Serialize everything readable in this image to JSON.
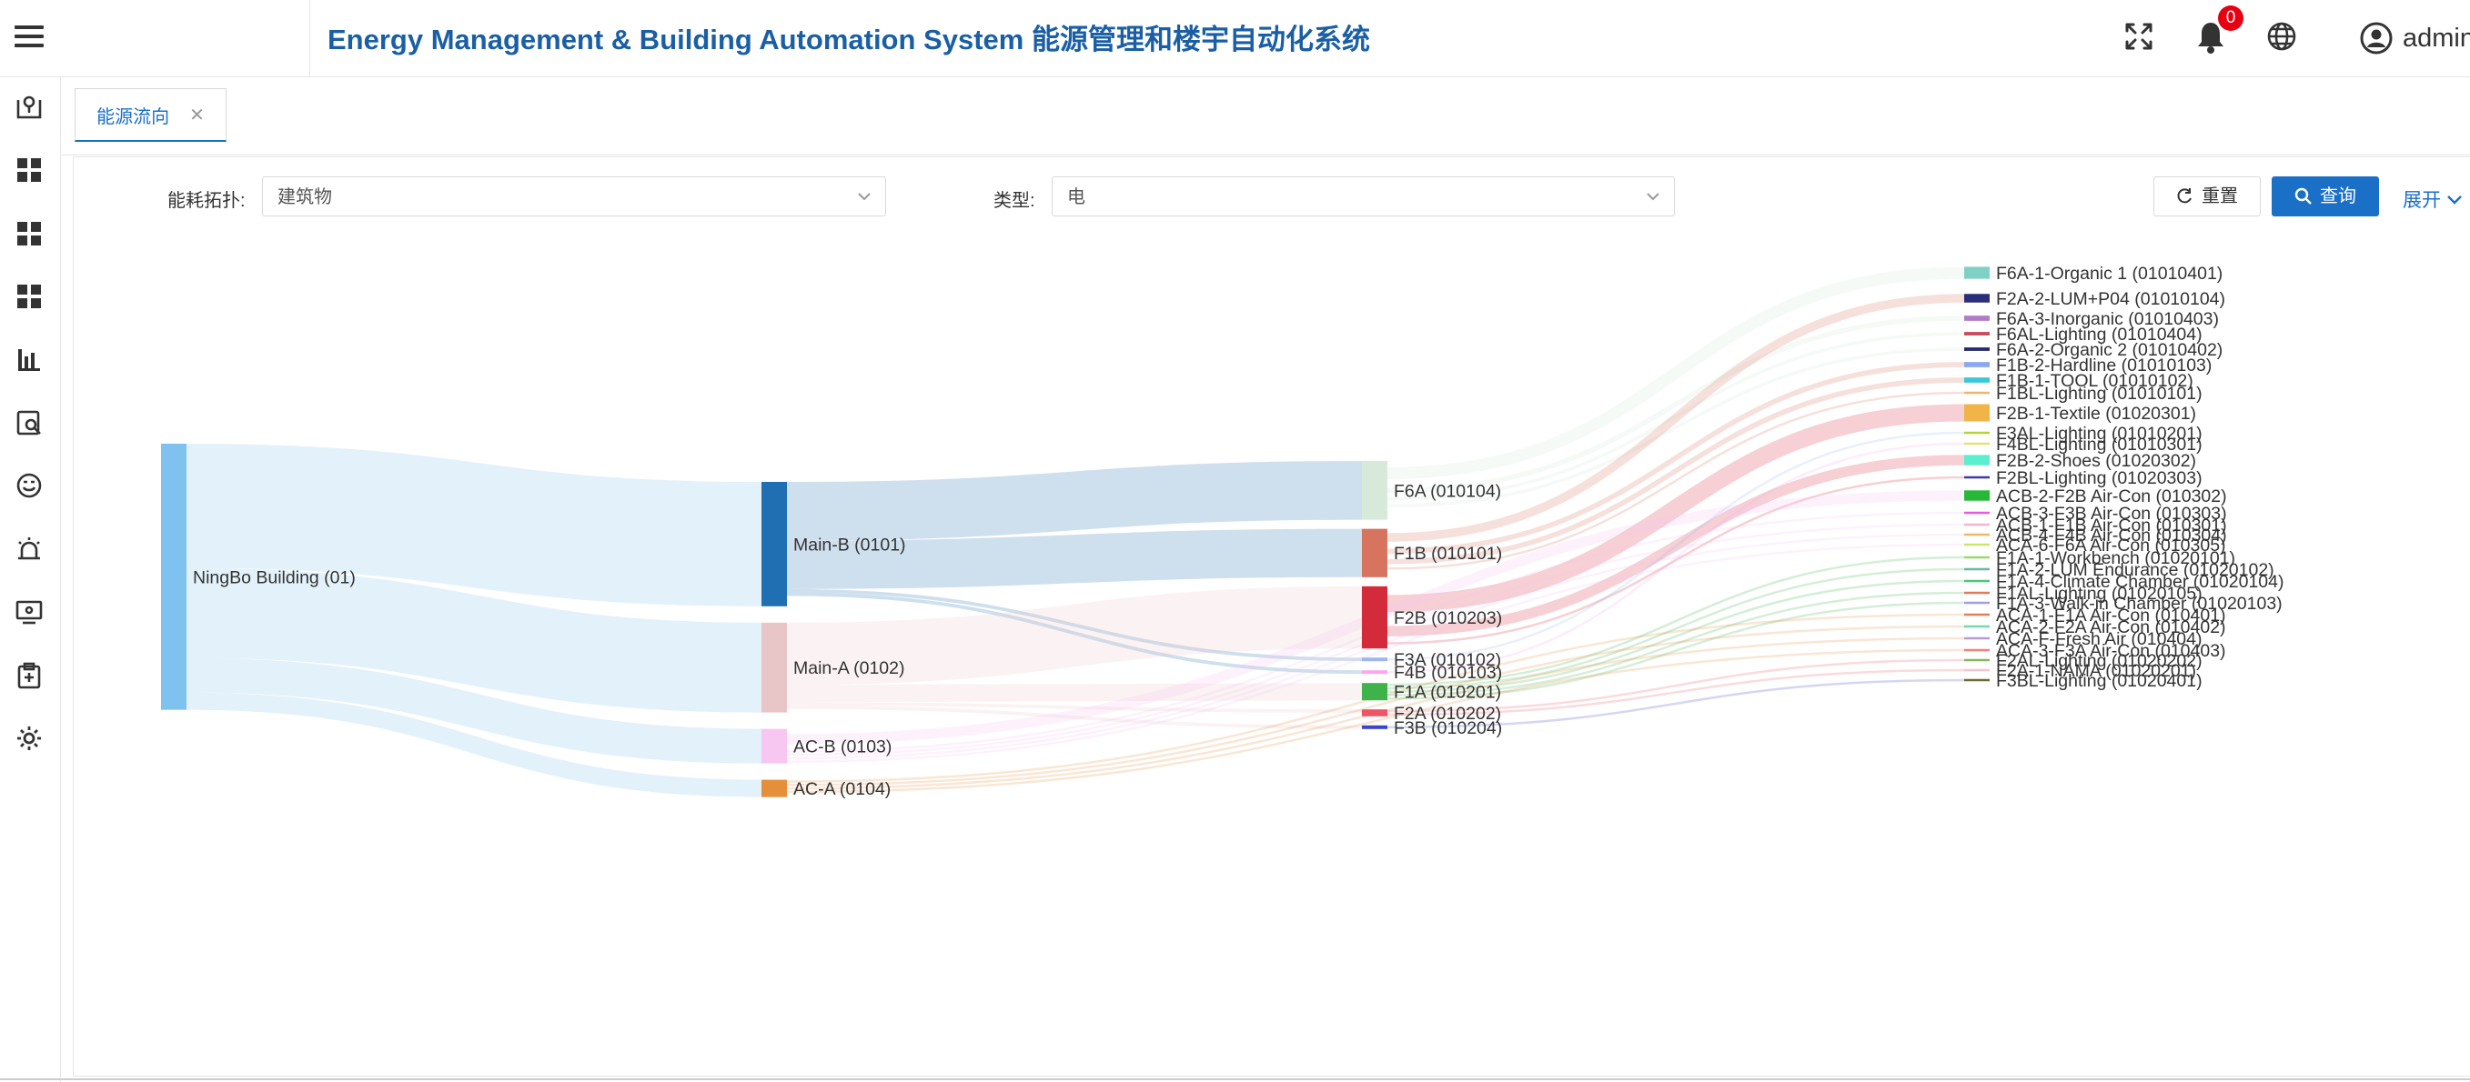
{
  "header": {
    "title": "Energy Management & Building Automation System 能源管理和楼宇自动化系统",
    "notification_count": "0",
    "user_name": "admin"
  },
  "icons": {
    "menu": "hamburger-icon",
    "fullscreen": "fullscreen-icon",
    "notifications": "bell-icon",
    "language": "globe-icon",
    "user": "user-circle-icon"
  },
  "sidebar": {
    "items": [
      {
        "icon": "map-pin-icon"
      },
      {
        "icon": "dashboard-icon"
      },
      {
        "icon": "dashboard-icon"
      },
      {
        "icon": "dashboard-icon"
      },
      {
        "icon": "bar-chart-icon"
      },
      {
        "icon": "report-search-icon"
      },
      {
        "icon": "face-icon"
      },
      {
        "icon": "alarm-icon"
      },
      {
        "icon": "monitor-icon"
      },
      {
        "icon": "clipboard-icon"
      },
      {
        "icon": "settings-icon"
      }
    ]
  },
  "tabs": [
    {
      "label": "能源流向",
      "active": true
    }
  ],
  "filters": {
    "topology_label": "能耗拓扑:",
    "topology_value": "建筑物",
    "type_label": "类型:",
    "type_value": "电",
    "reset_label": "重置",
    "query_label": "查询",
    "expand_label": "展开"
  },
  "colors": {
    "primary": "#1a6fc7",
    "title": "#1a5fa6",
    "badge": "#e60012"
  },
  "chart_data": {
    "type": "sankey",
    "nodes": [
      {
        "id": "n01",
        "label": "NingBo Building (01)",
        "level": 0,
        "color": "#7fc1ef"
      },
      {
        "id": "n0101",
        "label": "Main-B (0101)",
        "level": 1,
        "color": "#1f6fb2"
      },
      {
        "id": "n0102",
        "label": "Main-A (0102)",
        "level": 1,
        "color": "#e8c6c8"
      },
      {
        "id": "n0103",
        "label": "AC-B (0103)",
        "level": 1,
        "color": "#f7c6f1"
      },
      {
        "id": "n0104",
        "label": "AC-A (0104)",
        "level": 1,
        "color": "#e58f3a"
      },
      {
        "id": "n010104",
        "label": "F6A (010104)",
        "level": 2,
        "color": "#d7e9d9"
      },
      {
        "id": "n010101",
        "label": "F1B (010101)",
        "level": 2,
        "color": "#d7745f"
      },
      {
        "id": "n010203",
        "label": "F2B (010203)",
        "level": 2,
        "color": "#d42b3b"
      },
      {
        "id": "n010102",
        "label": "F3A (010102)",
        "level": 2,
        "color": "#9db5f0"
      },
      {
        "id": "n010103",
        "label": "F4B (010103)",
        "level": 2,
        "color": "#f7a8ef"
      },
      {
        "id": "n010201",
        "label": "F1A (010201)",
        "level": 2,
        "color": "#3db34a"
      },
      {
        "id": "n010202",
        "label": "F2A (010202)",
        "level": 2,
        "color": "#ee5566"
      },
      {
        "id": "n010204",
        "label": "F3B (010204)",
        "level": 2,
        "color": "#3a46c8"
      },
      {
        "id": "l01010401",
        "label": "F6A-1-Organic 1 (01010401)",
        "level": 3,
        "color": "#7fd1c6"
      },
      {
        "id": "l01010104",
        "label": "F2A-2-LUM+P04 (01010104)",
        "level": 3,
        "color": "#2b2f7a"
      },
      {
        "id": "l01010403",
        "label": "F6A-3-Inorganic (01010403)",
        "level": 3,
        "color": "#b07cc8"
      },
      {
        "id": "l01010404",
        "label": "F6AL-Lighting (01010404)",
        "level": 3,
        "color": "#c64a5a"
      },
      {
        "id": "l01010402",
        "label": "F6A-2-Organic 2 (01010402)",
        "level": 3,
        "color": "#262a6e"
      },
      {
        "id": "l01010103",
        "label": "F1B-2-Hardline (01010103)",
        "level": 3,
        "color": "#8aa8f2"
      },
      {
        "id": "l01010102",
        "label": "F1B-1-TOOL (01010102)",
        "level": 3,
        "color": "#38c8d8"
      },
      {
        "id": "l01010101",
        "label": "F1BL-Lighting (01010101)",
        "level": 3,
        "color": "#f0b56a"
      },
      {
        "id": "l01020301",
        "label": "F2B-1-Textile (01020301)",
        "level": 3,
        "color": "#f0b448"
      },
      {
        "id": "l01010201",
        "label": "F3AL-Lighting (01010201)",
        "level": 3,
        "color": "#b8d23a"
      },
      {
        "id": "l01010301",
        "label": "F4BL-Lighting (01010301)",
        "level": 3,
        "color": "#e8e070"
      },
      {
        "id": "l01020302",
        "label": "F2B-2-Shoes (01020302)",
        "level": 3,
        "color": "#5af0cf"
      },
      {
        "id": "l01020303",
        "label": "F2BL-Lighting (01020303)",
        "level": 3,
        "color": "#3a3aa6"
      },
      {
        "id": "l010302",
        "label": "ACB-2-F2B Air-Con (010302)",
        "level": 3,
        "color": "#28b838"
      },
      {
        "id": "l010303",
        "label": "ACB-3-F3B Air-Con (010303)",
        "level": 3,
        "color": "#e85ae0"
      },
      {
        "id": "l010301",
        "label": "ACB-1-F1B Air-Con (010301)",
        "level": 3,
        "color": "#f4b4d6"
      },
      {
        "id": "l010304",
        "label": "ACB-4-F4B Air-Con (010304)",
        "level": 3,
        "color": "#f0b86a"
      },
      {
        "id": "l010305",
        "label": "ACA-6-F6A Air-Con (010305)",
        "level": 3,
        "color": "#c8e86a"
      },
      {
        "id": "l01020101",
        "label": "F1A-1-Workbench (01020101)",
        "level": 3,
        "color": "#9ad86a"
      },
      {
        "id": "l01020102",
        "label": "F1A-2-LUM Endurance (01020102)",
        "level": 3,
        "color": "#6ab8a0"
      },
      {
        "id": "l01020104",
        "label": "F1A-4-Climate Chamber (01020104)",
        "level": 3,
        "color": "#4ac878"
      },
      {
        "id": "l01020105",
        "label": "F1AL-Lighting (01020105)",
        "level": 3,
        "color": "#e07a5a"
      },
      {
        "id": "l01020103",
        "label": "F1A-3-Walk-in Chamber (01020103)",
        "level": 3,
        "color": "#a0a0e0"
      },
      {
        "id": "l010401",
        "label": "ACA-1-F1A Air-Con (010401)",
        "level": 3,
        "color": "#e0805a"
      },
      {
        "id": "l010402",
        "label": "ACA-2-F2A Air-Con (010402)",
        "level": 3,
        "color": "#78d8b0"
      },
      {
        "id": "l010404",
        "label": "ACA-F-Fresh Air (010404)",
        "level": 3,
        "color": "#b89ad8"
      },
      {
        "id": "l010403",
        "label": "ACA-3-F3A Air-Con (010403)",
        "level": 3,
        "color": "#f08080"
      },
      {
        "id": "l01020202",
        "label": "F2AL-Lighting (01020202)",
        "level": 3,
        "color": "#80b860"
      },
      {
        "id": "l01020201",
        "label": "F2A-1-NAMA (01020201)",
        "level": 3,
        "color": "#f4c4d4"
      },
      {
        "id": "l01020401",
        "label": "F3BL-Lighting (01020401)",
        "level": 3,
        "color": "#6a6a3a"
      }
    ],
    "links": [
      {
        "source": "n01",
        "target": "n0101",
        "value": 36
      },
      {
        "source": "n01",
        "target": "n0102",
        "value": 26
      },
      {
        "source": "n01",
        "target": "n0103",
        "value": 10
      },
      {
        "source": "n01",
        "target": "n0104",
        "value": 5
      },
      {
        "source": "n0101",
        "target": "n010104",
        "value": 17
      },
      {
        "source": "n0101",
        "target": "n010101",
        "value": 14
      },
      {
        "source": "n0101",
        "target": "n010102",
        "value": 1
      },
      {
        "source": "n0101",
        "target": "n010103",
        "value": 1
      },
      {
        "source": "n0102",
        "target": "n010203",
        "value": 18
      },
      {
        "source": "n0102",
        "target": "n010201",
        "value": 5
      },
      {
        "source": "n0102",
        "target": "n010202",
        "value": 1
      },
      {
        "source": "n0102",
        "target": "n010204",
        "value": 1
      },
      {
        "source": "n010104",
        "target": "l01010401",
        "value": 7
      },
      {
        "source": "n010104",
        "target": "l01010403",
        "value": 3
      },
      {
        "source": "n010104",
        "target": "l01010404",
        "value": 2
      },
      {
        "source": "n010104",
        "target": "l01010402",
        "value": 2
      },
      {
        "source": "n010101",
        "target": "l01010104",
        "value": 5
      },
      {
        "source": "n010101",
        "target": "l01010103",
        "value": 3
      },
      {
        "source": "n010101",
        "target": "l01010102",
        "value": 3
      },
      {
        "source": "n010101",
        "target": "l01010101",
        "value": 1
      },
      {
        "source": "n010203",
        "target": "l01020301",
        "value": 10
      },
      {
        "source": "n010203",
        "target": "l01020302",
        "value": 6
      },
      {
        "source": "n010203",
        "target": "l01020303",
        "value": 1
      },
      {
        "source": "n010102",
        "target": "l01010201",
        "value": 1
      },
      {
        "source": "n010103",
        "target": "l01010301",
        "value": 1
      },
      {
        "source": "n0103",
        "target": "l010302",
        "value": 6
      },
      {
        "source": "n0103",
        "target": "l010303",
        "value": 1
      },
      {
        "source": "n0103",
        "target": "l010301",
        "value": 1
      },
      {
        "source": "n0103",
        "target": "l010304",
        "value": 1
      },
      {
        "source": "n0103",
        "target": "l010305",
        "value": 1
      },
      {
        "source": "n010201",
        "target": "l01020101",
        "value": 1
      },
      {
        "source": "n010201",
        "target": "l01020102",
        "value": 1
      },
      {
        "source": "n010201",
        "target": "l01020104",
        "value": 1
      },
      {
        "source": "n010201",
        "target": "l01020105",
        "value": 1
      },
      {
        "source": "n010201",
        "target": "l01020103",
        "value": 1
      },
      {
        "source": "n0104",
        "target": "l010401",
        "value": 1
      },
      {
        "source": "n0104",
        "target": "l010402",
        "value": 1
      },
      {
        "source": "n0104",
        "target": "l010404",
        "value": 1
      },
      {
        "source": "n0104",
        "target": "l010403",
        "value": 1
      },
      {
        "source": "n010202",
        "target": "l01020202",
        "value": 1
      },
      {
        "source": "n010202",
        "target": "l01020201",
        "value": 1
      },
      {
        "source": "n010204",
        "target": "l01020401",
        "value": 1
      }
    ]
  }
}
